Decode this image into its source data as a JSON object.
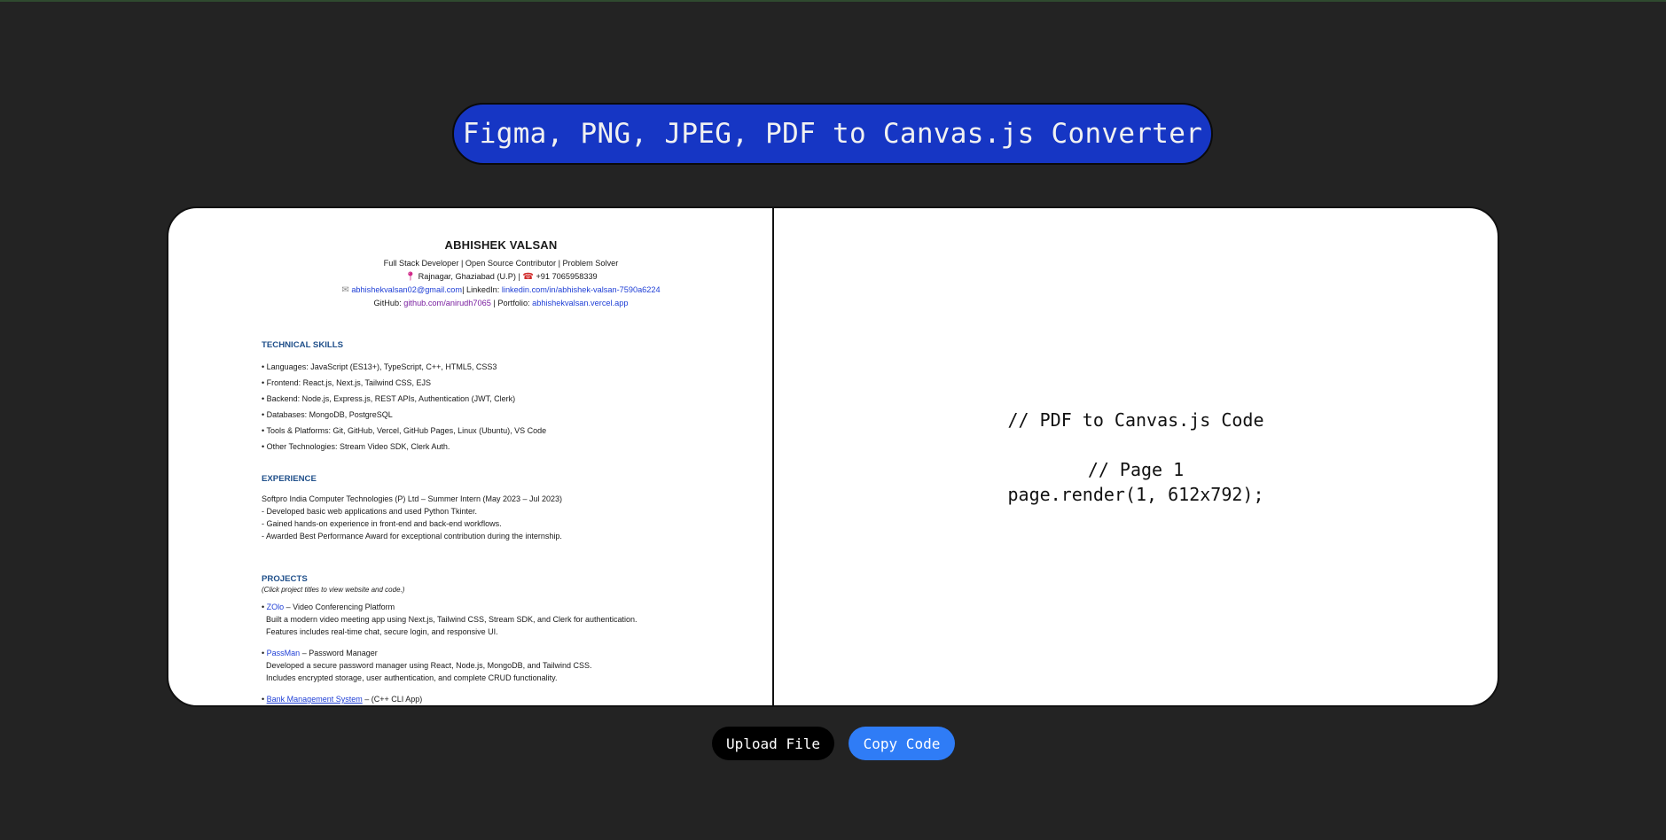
{
  "app": {
    "title": "Figma, PNG, JPEG, PDF to Canvas.js Converter"
  },
  "resume": {
    "name": "ABHISHEK VALSAN",
    "tagline": "Full Stack Developer | Open Source Contributor | Problem Solver",
    "location": "Rajnagar, Ghaziabad (U.P)",
    "phone": "+91 7065958339",
    "email": "abhishekvalsan02@gmail.com",
    "linkedin_label": "| LinkedIn:",
    "linkedin": "linkedin.com/in/abhishek-valsan-7590a6224",
    "github_label": "GitHub:",
    "github": "github.com/anirudh7065",
    "portfolio_label": "| Portfolio:",
    "portfolio": "abhishekvalsan.vercel.app",
    "skills_title": "TECHNICAL SKILLS",
    "skills": [
      "• Languages: JavaScript (ES13+), TypeScript, C++, HTML5, CSS3",
      "• Frontend: React.js, Next.js, Tailwind CSS, EJS",
      "• Backend: Node.js, Express.js, REST APIs, Authentication (JWT, Clerk)",
      "• Databases: MongoDB, PostgreSQL",
      "• Tools & Platforms: Git, GitHub, Vercel, GitHub Pages, Linux (Ubuntu), VS Code",
      "• Other Technologies: Stream Video SDK, Clerk Auth."
    ],
    "experience_title": "EXPERIENCE",
    "experience": [
      "Softpro India Computer Technologies (P) Ltd – Summer Intern (May 2023 – Jul 2023)",
      "- Developed basic web applications and used Python Tkinter.",
      "- Gained hands-on experience in front-end and back-end workflows.",
      "- Awarded Best Performance Award for exceptional contribution during the internship."
    ],
    "projects_title": "PROJECTS",
    "projects_note": "(Click project titles to view website and code.)",
    "projects": [
      {
        "name": "ZOlo",
        "suffix": " – Video Conferencing Platform",
        "lines": [
          "Built a modern video meeting app using Next.js, Tailwind CSS, Stream SDK, and Clerk for authentication.",
          "Features includes real-time chat, secure login, and responsive UI."
        ]
      },
      {
        "name": "PassMan",
        "suffix": " – Password Manager",
        "lines": [
          "Developed a secure password manager using React, Node.js, MongoDB, and Tailwind CSS.",
          "Includes encrypted storage, user authentication, and complete CRUD functionality."
        ]
      },
      {
        "name": "Bank Management System",
        "suffix": " – (C++ CLI App)",
        "lines": []
      }
    ]
  },
  "code": {
    "comment": "// PDF to Canvas.js Code",
    "page_comment": "// Page 1",
    "statement": "page.render(1, 612x792);"
  },
  "buttons": {
    "upload": "Upload File",
    "copy": "Copy Code"
  },
  "colors": {
    "background": "#232323",
    "title_pill": "#1636c4",
    "copy_button": "#2f7cf6",
    "upload_button": "#000000",
    "link": "#1f3fd6",
    "section_heading": "#1f4f8a"
  }
}
